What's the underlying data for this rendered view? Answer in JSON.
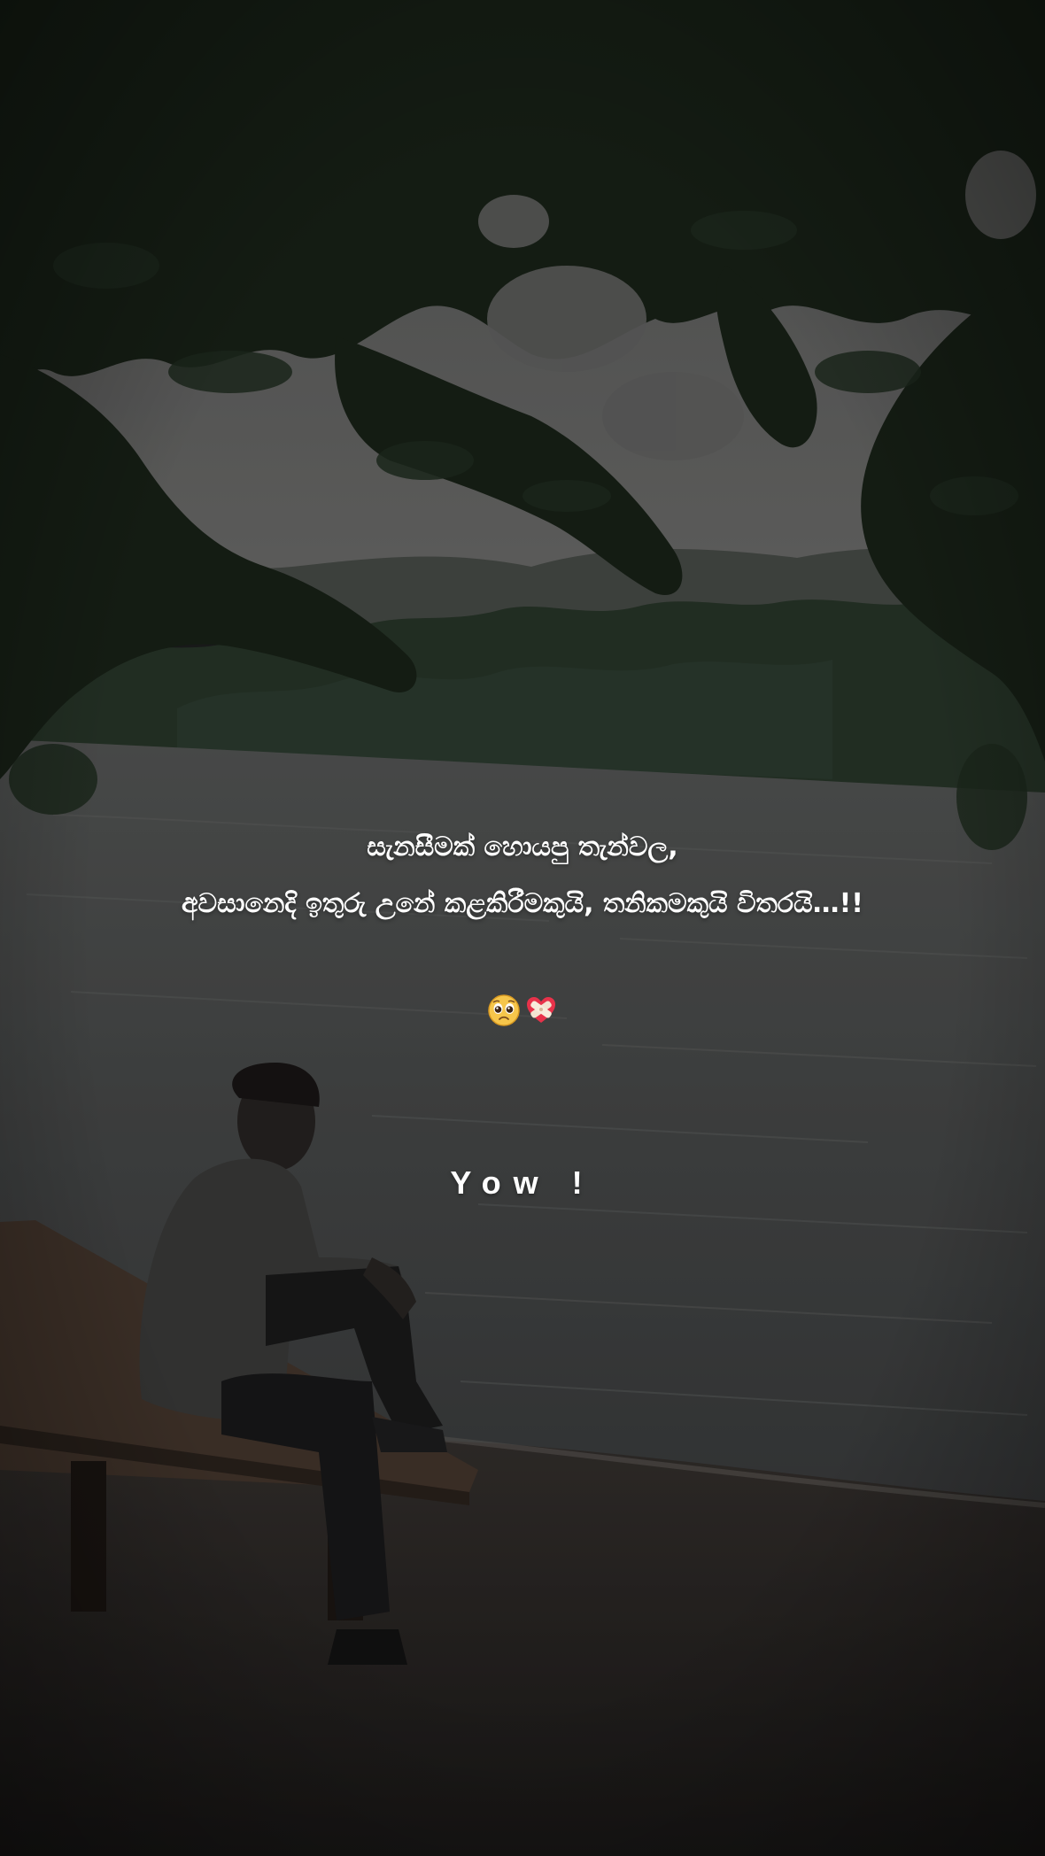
{
  "caption": {
    "line1": "සැනසීමක් හොයපු තැන්වල,",
    "line2": "අවසානෙදි ඉතුරු උනේ කළකිරීමකුයි, තනිකමකුයි විතරයි…!!"
  },
  "emojis": [
    "pleading-face",
    "mending-heart"
  ],
  "signature": "Yow !",
  "colors": {
    "text": "#ffffff",
    "sky": "#6b6b6b",
    "water": "#4a4c4c",
    "foliage": "#1c2a1c",
    "ground": "#2a2725"
  }
}
